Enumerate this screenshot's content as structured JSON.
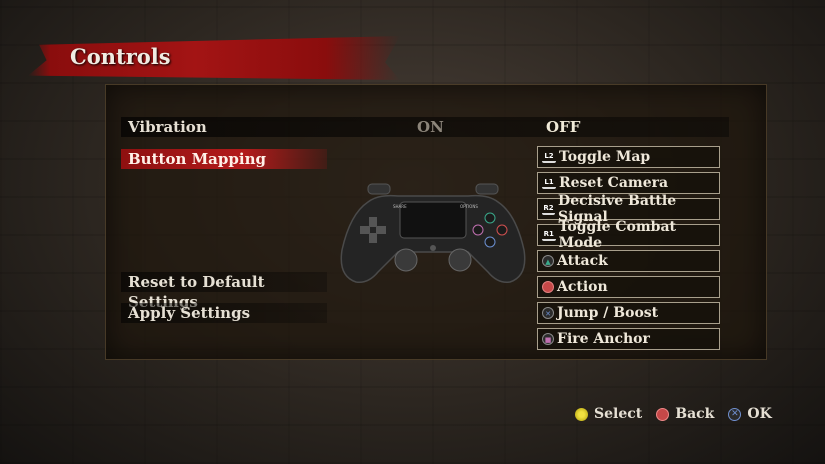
{
  "screen": {
    "title": "Controls"
  },
  "vibration": {
    "label": "Vibration",
    "on": "ON",
    "off": "OFF",
    "selected": "OFF"
  },
  "menu": {
    "button_mapping": "Button Mapping",
    "reset": "Reset to Default Settings",
    "apply": "Apply Settings"
  },
  "mappings": [
    {
      "button": "L2",
      "icon": "l2-trigger-icon",
      "action": "Toggle Map"
    },
    {
      "button": "L1",
      "icon": "l1-bumper-icon",
      "action": "Reset Camera"
    },
    {
      "button": "R2",
      "icon": "r2-trigger-icon",
      "action": "Decisive Battle Signal"
    },
    {
      "button": "R1",
      "icon": "r1-bumper-icon",
      "action": "Toggle Combat Mode"
    },
    {
      "button": "Triangle",
      "icon": "triangle-button-icon",
      "action": "Attack"
    },
    {
      "button": "Circle",
      "icon": "circle-button-icon",
      "action": "Action"
    },
    {
      "button": "Cross",
      "icon": "cross-button-icon",
      "action": "Jump / Boost"
    },
    {
      "button": "Square",
      "icon": "square-button-icon",
      "action": "Fire Anchor"
    }
  ],
  "controller": {
    "share": "SHARE",
    "options": "OPTIONS"
  },
  "footer": {
    "select": "Select",
    "back": "Back",
    "ok": "OK"
  },
  "colors": {
    "accent_red": "#a31414",
    "triangle": "#3aa88a",
    "circle": "#d05050",
    "cross": "#6b8fd0",
    "square": "#c070b0",
    "dpad_yellow": "#d8d020"
  }
}
